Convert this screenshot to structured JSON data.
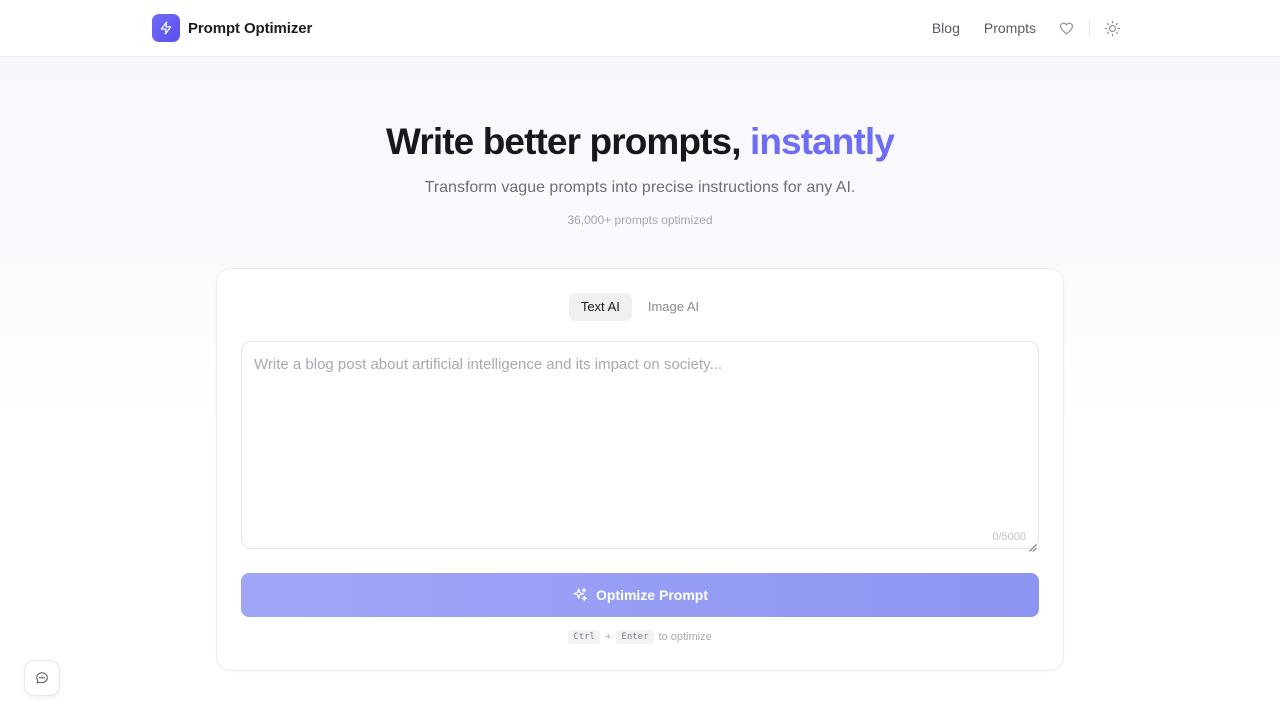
{
  "header": {
    "brand_name": "Prompt Optimizer",
    "nav": [
      {
        "label": "Blog"
      },
      {
        "label": "Prompts"
      }
    ],
    "icons": [
      "zap-icon",
      "heart-icon",
      "sun-icon"
    ]
  },
  "hero": {
    "title_main": "Write better prompts, ",
    "title_accent": "instantly",
    "subtitle": "Transform vague prompts into precise instructions for any AI.",
    "count": "36,000+ prompts optimized"
  },
  "card": {
    "tabs": [
      {
        "label": "Text AI",
        "active": true
      },
      {
        "label": "Image AI",
        "active": false
      }
    ],
    "prompt": {
      "value": "",
      "placeholder": "Write a blog post about artificial intelligence and its impact on society...",
      "char_count": "0/5000"
    },
    "optimize_label": "Optimize Prompt",
    "shortcut": {
      "key1": "Ctrl",
      "plus": "+",
      "key2": "Enter",
      "suffix": "to optimize"
    }
  },
  "colors": {
    "accent": "#6d6ef3",
    "button_gradient_start": "#a0a6f7",
    "button_gradient_end": "#8d95f2"
  }
}
